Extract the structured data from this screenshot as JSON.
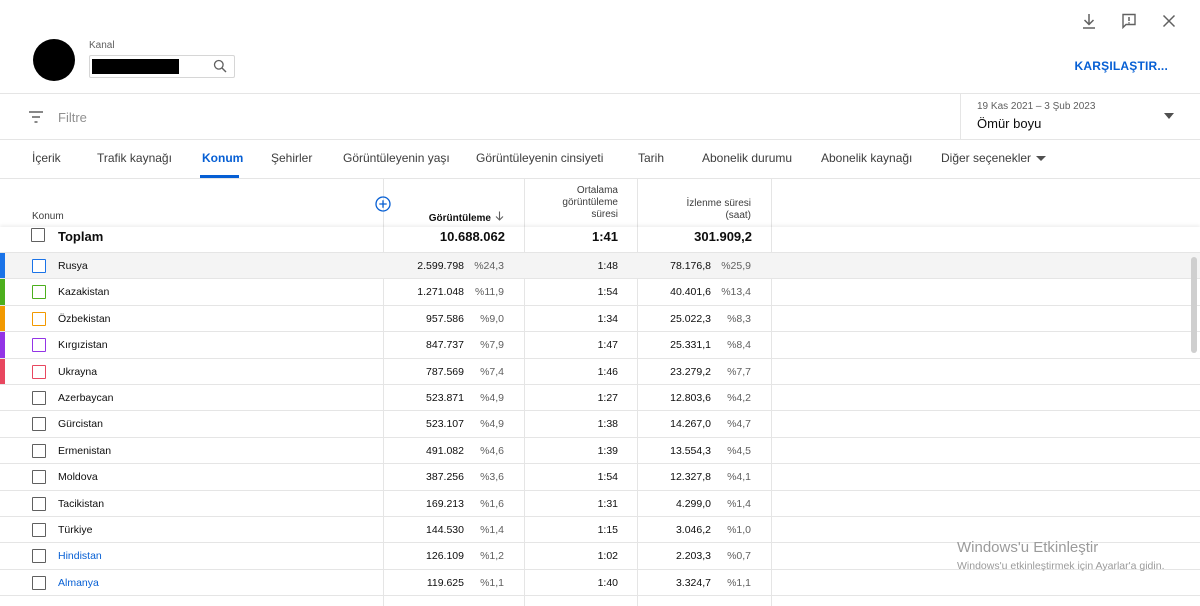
{
  "header": {
    "kanal_label": "Kanal",
    "compare_label": "KARŞILAŞTIR..."
  },
  "filter": {
    "placeholder": "Filtre",
    "date_range": "19 Kas 2021 – 3 Şub 2023",
    "date_label": "Ömür boyu"
  },
  "tabs": [
    {
      "label": "İçerik"
    },
    {
      "label": "Trafik kaynağı"
    },
    {
      "label": "Konum"
    },
    {
      "label": "Şehirler"
    },
    {
      "label": "Görüntüleyenin yaşı"
    },
    {
      "label": "Görüntüleyenin cinsiyeti"
    },
    {
      "label": "Tarih"
    },
    {
      "label": "Abonelik durumu"
    },
    {
      "label": "Abonelik kaynağı"
    },
    {
      "label": "Diğer seçenekler"
    }
  ],
  "table": {
    "headers": {
      "konum": "Konum",
      "views": "Görüntüleme",
      "avg_line1": "Ortalama",
      "avg_line2": "görüntüleme",
      "avg_line3": "süresi",
      "watch_line1": "İzlenme süresi",
      "watch_line2": "(saat)"
    },
    "total": {
      "label": "Toplam",
      "views": "10.688.062",
      "avg": "1:41",
      "watch": "301.909,2"
    },
    "rows": [
      {
        "name": "Rusya",
        "views": "2.599.798",
        "views_pct": "%24,3",
        "avg": "1:48",
        "watch": "78.176,8",
        "watch_pct": "%25,9",
        "color": "#1a73e8"
      },
      {
        "name": "Kazakistan",
        "views": "1.271.048",
        "views_pct": "%11,9",
        "avg": "1:54",
        "watch": "40.401,6",
        "watch_pct": "%13,4",
        "color": "#4caf1d"
      },
      {
        "name": "Özbekistan",
        "views": "957.586",
        "views_pct": "%9,0",
        "avg": "1:34",
        "watch": "25.022,3",
        "watch_pct": "%8,3",
        "color": "#f29900"
      },
      {
        "name": "Kırgızistan",
        "views": "847.737",
        "views_pct": "%7,9",
        "avg": "1:47",
        "watch": "25.331,1",
        "watch_pct": "%8,4",
        "color": "#9334e6"
      },
      {
        "name": "Ukrayna",
        "views": "787.569",
        "views_pct": "%7,4",
        "avg": "1:46",
        "watch": "23.279,2",
        "watch_pct": "%7,7",
        "color": "#e8475f"
      },
      {
        "name": "Azerbaycan",
        "views": "523.871",
        "views_pct": "%4,9",
        "avg": "1:27",
        "watch": "12.803,6",
        "watch_pct": "%4,2",
        "color": ""
      },
      {
        "name": "Gürcistan",
        "views": "523.107",
        "views_pct": "%4,9",
        "avg": "1:38",
        "watch": "14.267,0",
        "watch_pct": "%4,7",
        "color": ""
      },
      {
        "name": "Ermenistan",
        "views": "491.082",
        "views_pct": "%4,6",
        "avg": "1:39",
        "watch": "13.554,3",
        "watch_pct": "%4,5",
        "color": ""
      },
      {
        "name": "Moldova",
        "views": "387.256",
        "views_pct": "%3,6",
        "avg": "1:54",
        "watch": "12.327,8",
        "watch_pct": "%4,1",
        "color": ""
      },
      {
        "name": "Tacikistan",
        "views": "169.213",
        "views_pct": "%1,6",
        "avg": "1:31",
        "watch": "4.299,0",
        "watch_pct": "%1,4",
        "color": ""
      },
      {
        "name": "Türkiye",
        "views": "144.530",
        "views_pct": "%1,4",
        "avg": "1:15",
        "watch": "3.046,2",
        "watch_pct": "%1,0",
        "color": ""
      },
      {
        "name": "Hindistan",
        "views": "126.109",
        "views_pct": "%1,2",
        "avg": "1:02",
        "watch": "2.203,3",
        "watch_pct": "%0,7",
        "color": "",
        "link": true
      },
      {
        "name": "Almanya",
        "views": "119.625",
        "views_pct": "%1,1",
        "avg": "1:40",
        "watch": "3.324,7",
        "watch_pct": "%1,1",
        "color": "",
        "link": true
      }
    ]
  },
  "watermark": {
    "line1": "Windows'u Etkinleştir",
    "line2": "Windows'u etkinleştirmek için Ayarlar'a gidin."
  }
}
